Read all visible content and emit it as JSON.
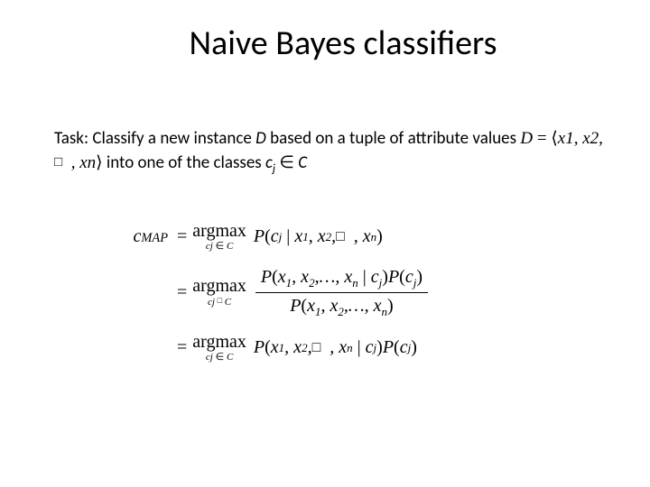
{
  "title": "Naive Bayes classifiers",
  "task": {
    "prefix": "Task: Classify a new instance ",
    "instance_var": "D",
    "mid1": " based on a tuple of attribute values ",
    "tuple_inline": "D = ⟨x₁, x₂, … , xₙ⟩",
    "mid2": " into one of the classes ",
    "class_var": "c",
    "class_sub": "j",
    "elem": " ∈ ",
    "set_var": "C"
  },
  "formula": {
    "lhs_c": "c",
    "lhs_map": "MAP",
    "eq": "=",
    "argmax": "argmax",
    "argmax_sub1": "cⱼ ∈ C",
    "argmax_sub2": "cⱼ □ C",
    "line1_rhs": "P(cⱼ | x₁, x₂, … , xₙ)",
    "line2_num": "P(x₁, x₂, …, xₙ | cⱼ) P(cⱼ)",
    "line2_den": "P(x₁, x₂, …, xₙ)",
    "line3_rhs": "P(x₁, x₂, … , xₙ | cⱼ) P(cⱼ)"
  }
}
